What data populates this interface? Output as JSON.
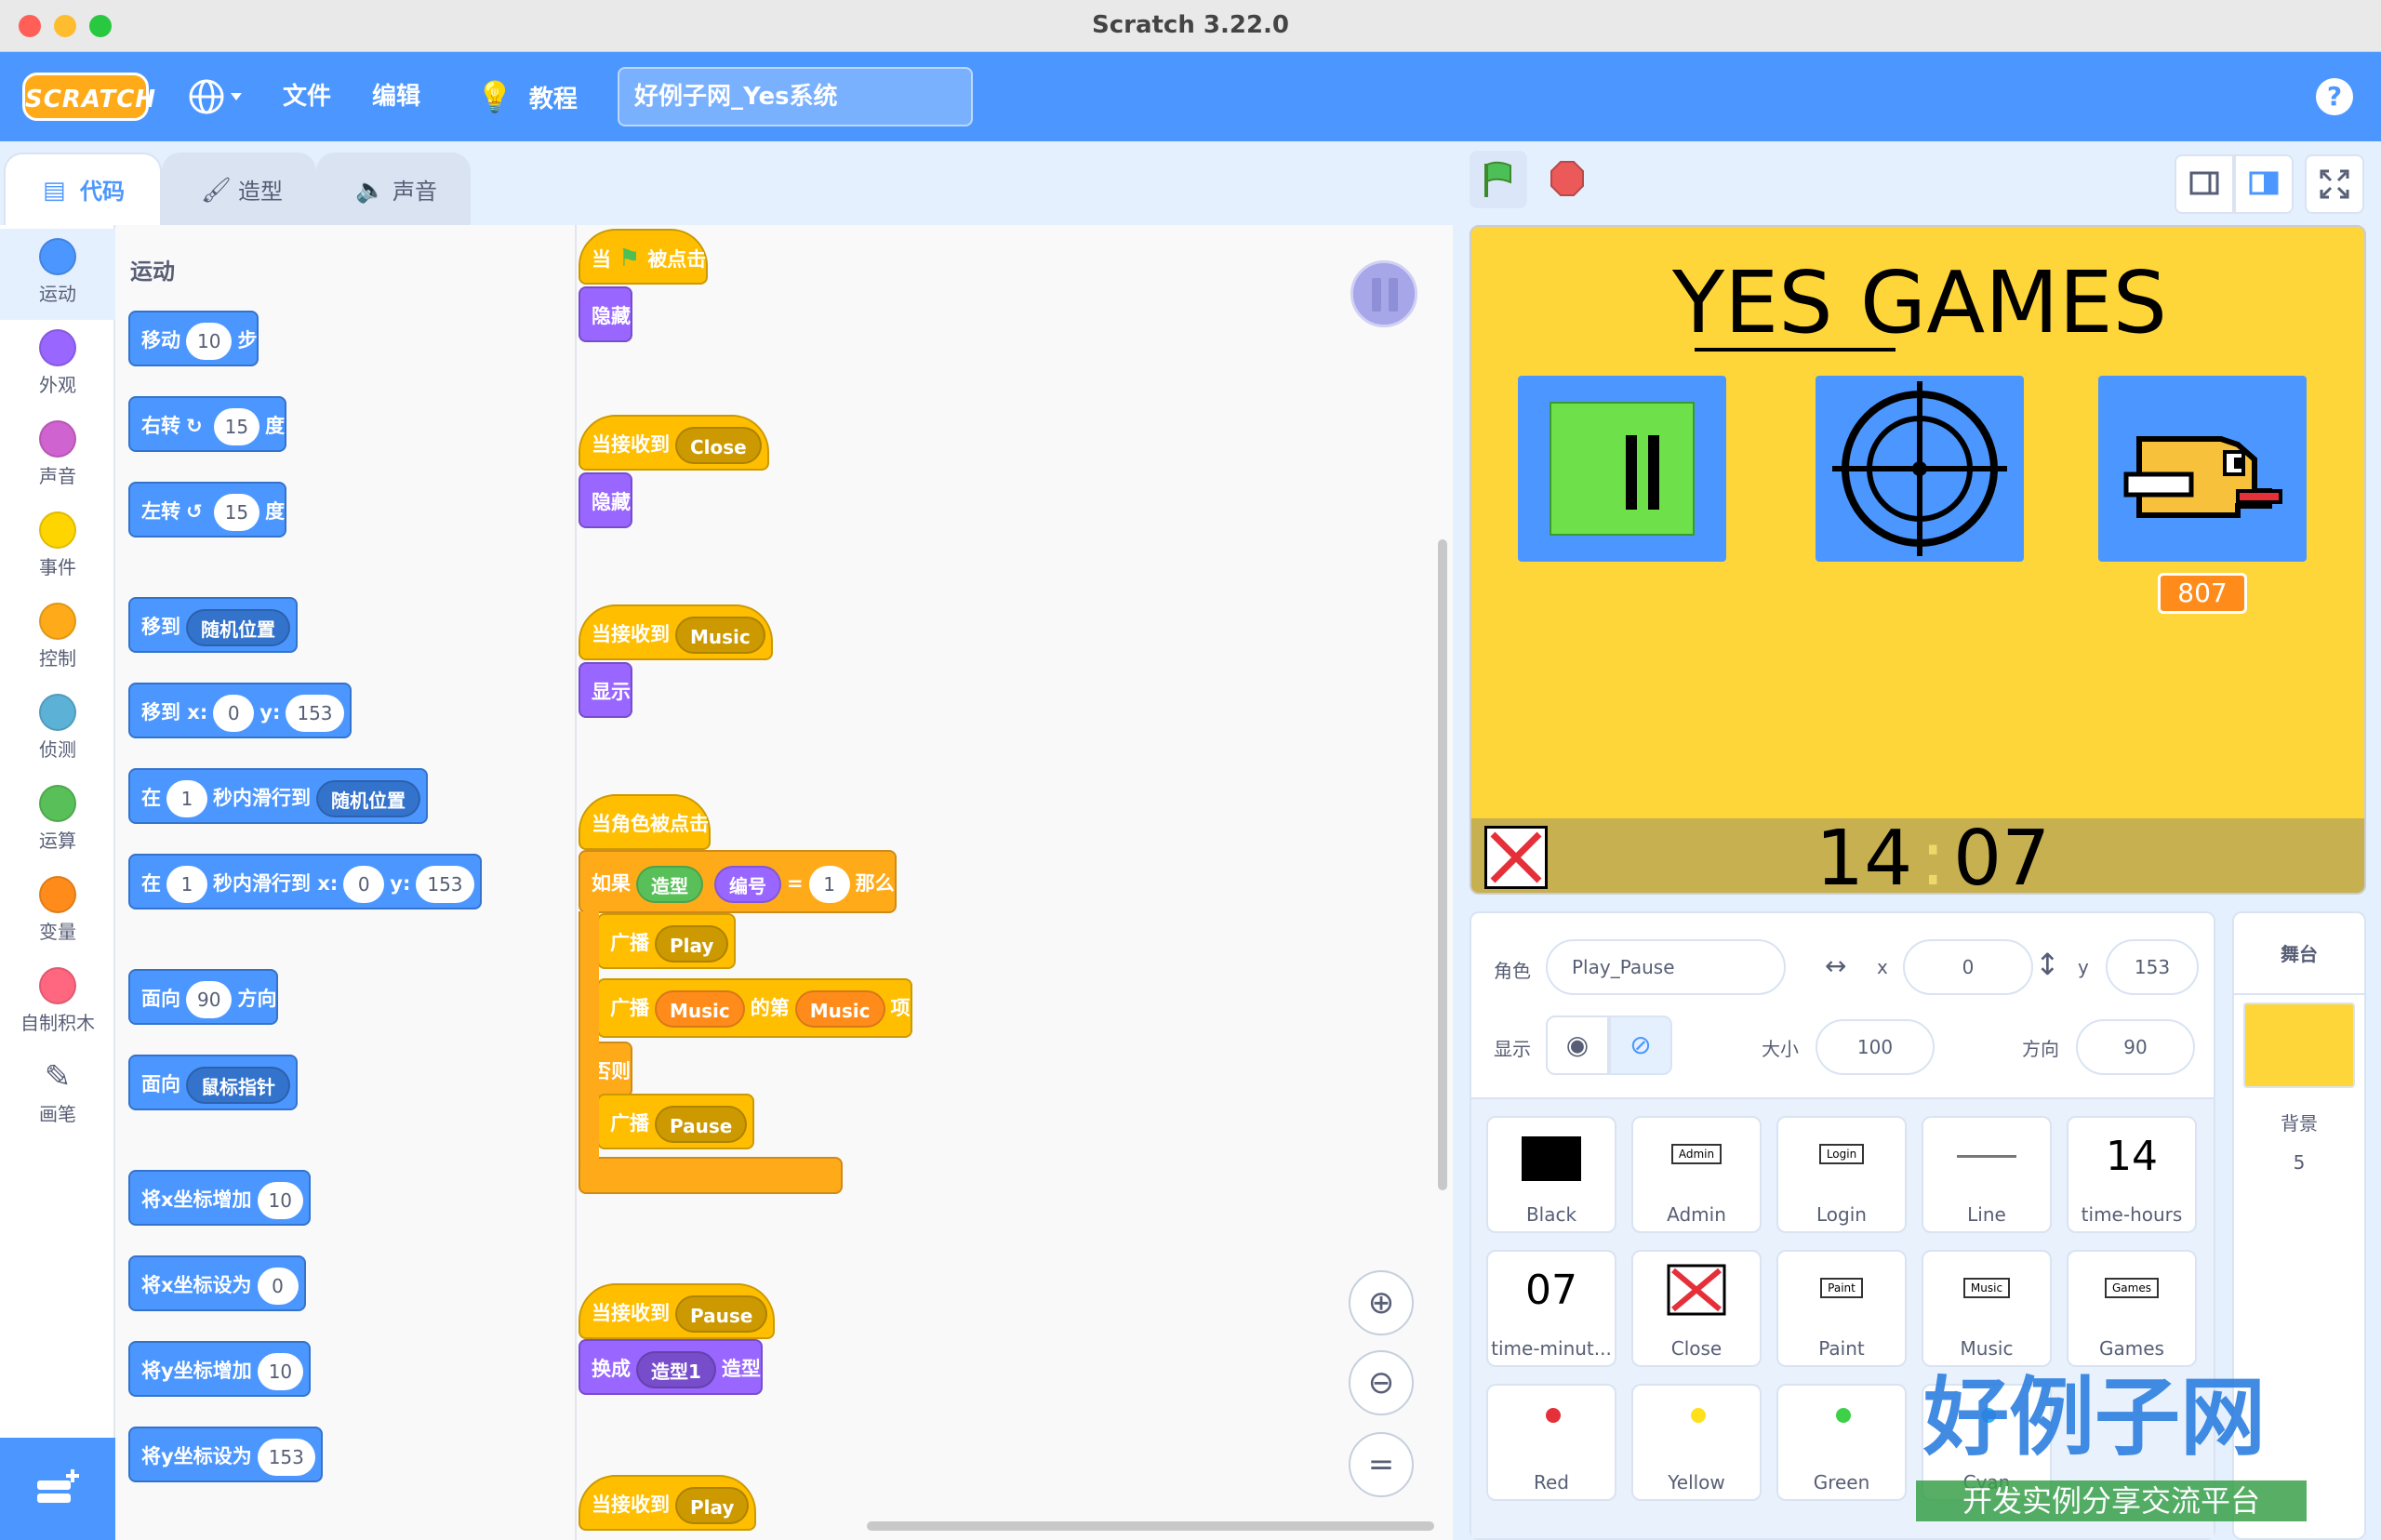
{
  "window": {
    "title": "Scratch 3.22.0"
  },
  "menubar": {
    "logo": "SCRATCH",
    "file": "文件",
    "edit": "编辑",
    "tutorials": "教程",
    "project_name": "好例子网_Yes系统",
    "help": "?"
  },
  "tabs": [
    {
      "label": "代码",
      "active": true
    },
    {
      "label": "造型",
      "active": false
    },
    {
      "label": "声音",
      "active": false
    }
  ],
  "categories": [
    {
      "label": "运动",
      "color": "#4c97ff"
    },
    {
      "label": "外观",
      "color": "#9966ff"
    },
    {
      "label": "声音",
      "color": "#cf63cf"
    },
    {
      "label": "事件",
      "color": "#ffd500"
    },
    {
      "label": "控制",
      "color": "#ffab19"
    },
    {
      "label": "侦测",
      "color": "#5cb1d6"
    },
    {
      "label": "运算",
      "color": "#59c059"
    },
    {
      "label": "变量",
      "color": "#ff8c1a"
    },
    {
      "label": "自制积木",
      "color": "#ff6680"
    },
    {
      "label": "画笔",
      "color": "#0fbd8c"
    }
  ],
  "palette": {
    "title": "运动",
    "blocks": {
      "move": [
        "移动",
        "10",
        "步"
      ],
      "turn_right": [
        "右转",
        "15",
        "度"
      ],
      "turn_left": [
        "左转",
        "15",
        "度"
      ],
      "goto": [
        "移到",
        "随机位置"
      ],
      "goto_xy": [
        "移到 x:",
        "0",
        "y:",
        "153"
      ],
      "glide": [
        "在",
        "1",
        "秒内滑行到",
        "随机位置"
      ],
      "glide_xy": [
        "在",
        "1",
        "秒内滑行到 x:",
        "0",
        "y:",
        "153"
      ],
      "point_dir": [
        "面向",
        "90",
        "方向"
      ],
      "point_towards": [
        "面向",
        "鼠标指针"
      ],
      "change_x": [
        "将x坐标增加",
        "10"
      ],
      "set_x": [
        "将x坐标设为",
        "0"
      ],
      "change_y": [
        "将y坐标增加",
        "10"
      ],
      "set_y": [
        "将y坐标设为",
        "153"
      ]
    }
  },
  "scripts": {
    "s1_hat": [
      "当",
      "被点击"
    ],
    "s1_hide": "隐藏",
    "s2_hat": [
      "当接收到",
      "Close"
    ],
    "s2_hide": "隐藏",
    "s3_hat": [
      "当接收到",
      "Music"
    ],
    "s3_show": "显示",
    "s4_hat": "当角色被点击",
    "s4_if": [
      "如果",
      "造型",
      "编号",
      "=",
      "1",
      "那么"
    ],
    "s4_bc1": [
      "广播",
      "Play"
    ],
    "s4_bc2": [
      "广播",
      "Music",
      "的第",
      "Music",
      "项"
    ],
    "s4_else": "否则",
    "s4_bc3": [
      "广播",
      "Pause"
    ],
    "s5_hat": [
      "当接收到",
      "Pause"
    ],
    "s5_switch": [
      "换成",
      "造型1",
      "造型"
    ],
    "s6_hat": [
      "当接收到",
      "Play"
    ]
  },
  "stage": {
    "title": "YES GAMES",
    "score": "807",
    "clock_h": "14",
    "clock_m": "07"
  },
  "sprite_info": {
    "sprite_label": "角色",
    "sprite_name": "Play_Pause",
    "x_label": "x",
    "x_value": "0",
    "y_label": "y",
    "y_value": "153",
    "show_label": "显示",
    "size_label": "大小",
    "size_value": "100",
    "direction_label": "方向",
    "direction_value": "90"
  },
  "sprites": [
    {
      "name": "Black",
      "thumb": ""
    },
    {
      "name": "Admin",
      "thumb": "Admin"
    },
    {
      "name": "Login",
      "thumb": "Login"
    },
    {
      "name": "Line",
      "thumb": ""
    },
    {
      "name": "time-hours",
      "thumb": "14"
    },
    {
      "name": "time-minut...",
      "thumb": "07"
    },
    {
      "name": "Close",
      "thumb": ""
    },
    {
      "name": "Paint",
      "thumb": "Paint"
    },
    {
      "name": "Music",
      "thumb": "Music"
    },
    {
      "name": "Games",
      "thumb": "Games"
    },
    {
      "name": "Red",
      "thumb": "",
      "color": "#e5303a"
    },
    {
      "name": "Yellow",
      "thumb": "",
      "color": "#ffe01a"
    },
    {
      "name": "Green",
      "thumb": "",
      "color": "#3fd04a"
    },
    {
      "name": "Cyan",
      "thumb": "",
      "color": "#2fb3ea"
    }
  ],
  "stage_pane": {
    "title": "舞台",
    "backdrop_label": "背景",
    "backdrop_count": "5"
  },
  "watermark": {
    "line1": "好例子网",
    "line2": "开发实例分享交流平台"
  }
}
